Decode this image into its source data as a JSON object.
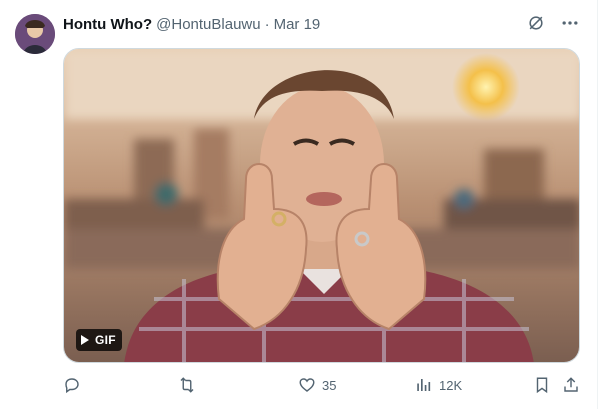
{
  "tweet": {
    "author": {
      "display_name": "Hontu Who?",
      "handle": "@HontuBlauwu",
      "separator": "·",
      "date": "Mar 19"
    },
    "media": {
      "badge_label": "GIF",
      "alt": ""
    },
    "actions": {
      "reply_count": "",
      "retweet_count": "",
      "like_count": "35",
      "views_count": "12K"
    }
  },
  "colors": {
    "text": "#0f1419",
    "muted": "#536471",
    "border": "#cfd9de"
  },
  "icons": [
    "grok-icon",
    "more-icon",
    "play-icon",
    "reply-icon",
    "retweet-icon",
    "like-icon",
    "views-icon",
    "bookmark-icon",
    "share-icon"
  ]
}
